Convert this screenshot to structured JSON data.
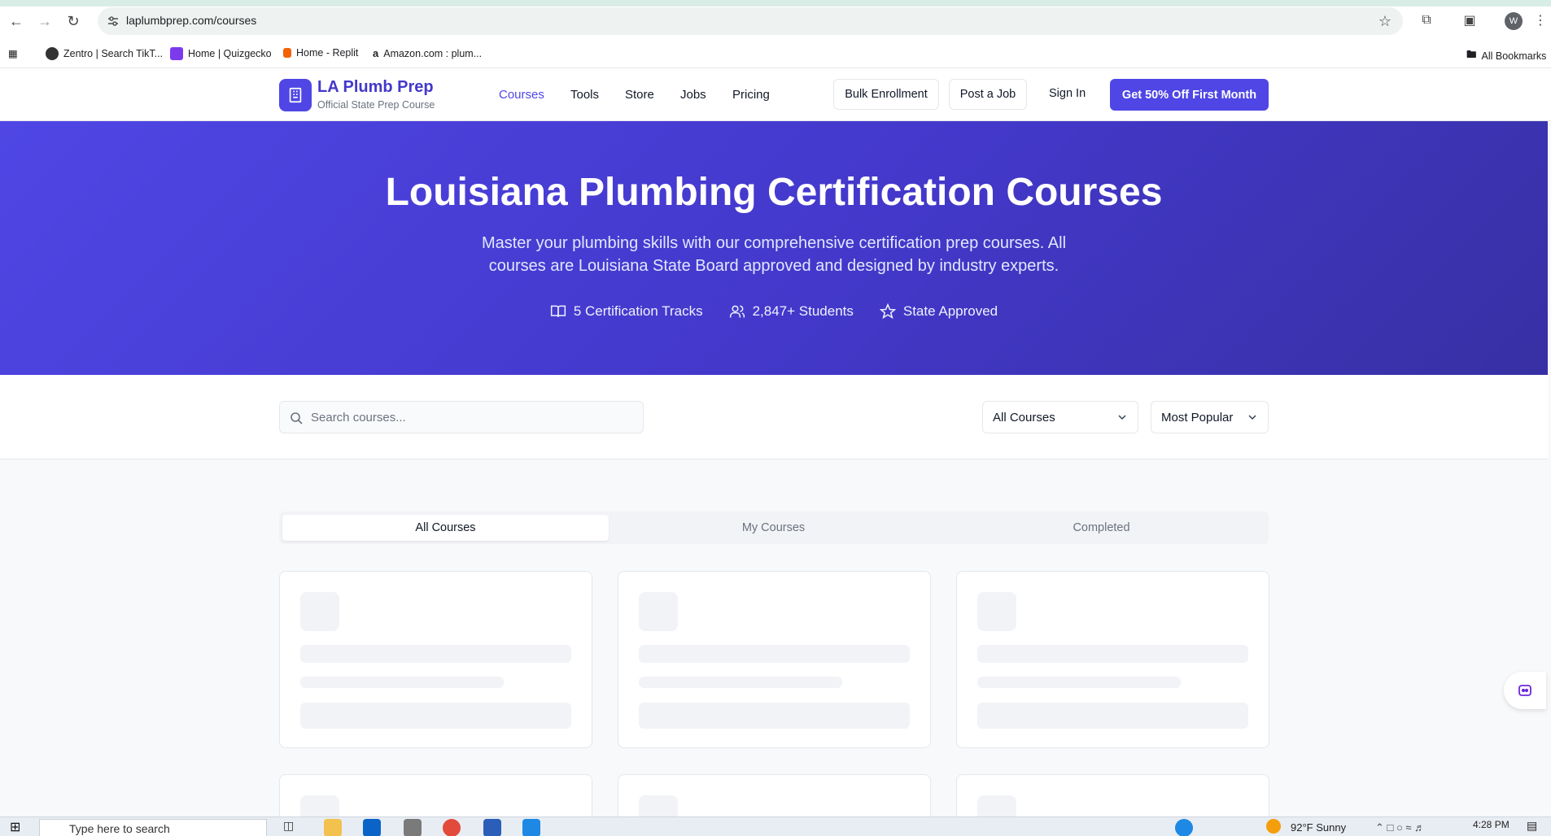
{
  "browser": {
    "url": "laplumbprep.com/courses",
    "profile_initial": "W",
    "bookmarks": [
      {
        "label": "Zentro | Search TikT...",
        "icon": "zentro-icon"
      },
      {
        "label": "Home | Quizgecko",
        "icon": "quizgecko-icon"
      },
      {
        "label": "Home - Replit",
        "icon": "replit-icon"
      },
      {
        "label": "Amazon.com : plum...",
        "icon": "amazon-icon"
      }
    ],
    "all_bookmarks_label": "All Bookmarks"
  },
  "header": {
    "logo_title": "LA Plumb Prep",
    "logo_subtitle": "Official State Prep Course",
    "nav": [
      "Courses",
      "Tools",
      "Store",
      "Jobs",
      "Pricing"
    ],
    "active_nav": "Courses",
    "bulk_enrollment": "Bulk Enrollment",
    "post_job": "Post a Job",
    "sign_in": "Sign In",
    "cta": "Get 50% Off First Month"
  },
  "hero": {
    "title": "Louisiana Plumbing Certification Courses",
    "subtitle": "Master your plumbing skills with our comprehensive certification prep courses. All courses are Louisiana State Board approved and designed by industry experts.",
    "stats": [
      {
        "icon": "book-icon",
        "label": "5 Certification Tracks"
      },
      {
        "icon": "users-icon",
        "label": "2,847+ Students"
      },
      {
        "icon": "star-icon",
        "label": "State Approved"
      }
    ]
  },
  "filters": {
    "search_placeholder": "Search courses...",
    "category_selected": "All Courses",
    "sort_selected": "Most Popular"
  },
  "tabs": [
    "All Courses",
    "My Courses",
    "Completed"
  ],
  "active_tab": "All Courses",
  "taskbar": {
    "search_placeholder": "Type here to search",
    "weather": "92°F  Sunny",
    "time": "4:28 PM"
  },
  "colors": {
    "brand": "#4f46e5",
    "brand_dark": "#3730a3",
    "skeleton": "#f1f3f6"
  }
}
